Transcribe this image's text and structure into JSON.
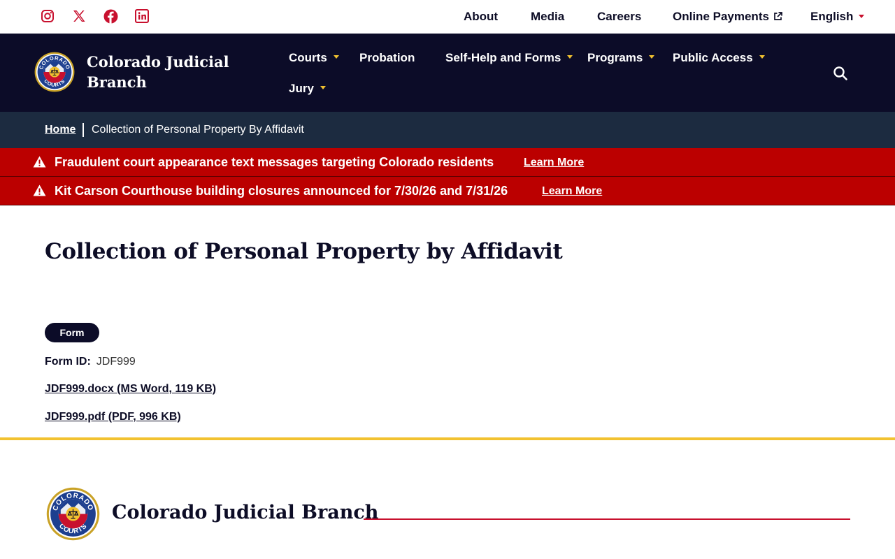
{
  "utility_nav": {
    "social": [
      "instagram-icon",
      "x-icon",
      "facebook-icon",
      "linkedin-icon"
    ],
    "links": {
      "about": "About",
      "media": "Media",
      "careers": "Careers",
      "online_payments": "Online Payments",
      "language": "English"
    }
  },
  "header": {
    "seal_top_text": "COLORADO",
    "seal_bottom_text": "COURTS",
    "brand_name": "Colorado Judicial Branch",
    "nav": {
      "courts": "Courts",
      "probation": "Probation",
      "self_help": "Self-Help and Forms",
      "programs": "Programs",
      "public_access": "Public Access",
      "jury": "Jury"
    }
  },
  "breadcrumb": {
    "home": "Home",
    "current": "Collection of Personal Property By Affidavit"
  },
  "alerts": [
    {
      "text": "Fraudulent court appearance text messages targeting Colorado residents",
      "link": "Learn More"
    },
    {
      "text": "Kit Carson Courthouse building closures announced for 7/30/26 and 7/31/26",
      "link": "Learn More"
    }
  ],
  "content": {
    "title": "Collection of Personal Property by Affidavit",
    "badge": "Form",
    "form_id_label": "Form ID:",
    "form_id_value": "JDF999",
    "files": [
      "JDF999.docx (MS Word, 119 KB)",
      "JDF999.pdf (PDF, 996 KB)"
    ]
  },
  "footer": {
    "brand_name": "Colorado Judicial Branch"
  },
  "colors": {
    "navy": "#0c0c28",
    "breadcrumb_bg": "#1c2b40",
    "alert_red": "#bb0000",
    "accent_red": "#c8102e",
    "gold": "#f2c230"
  }
}
